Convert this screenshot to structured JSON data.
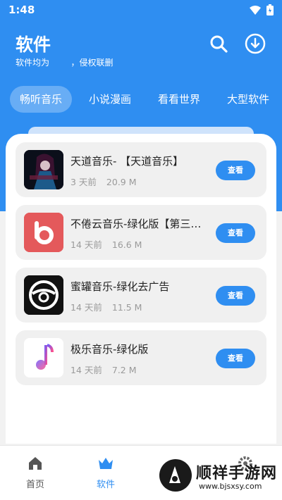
{
  "status_bar": {
    "time": "1:48"
  },
  "header": {
    "title": "软件",
    "subtitle": "软件均为        ，侵权联删"
  },
  "tabs": [
    {
      "label": "畅听音乐",
      "active": true
    },
    {
      "label": "小说漫画",
      "active": false
    },
    {
      "label": "看看世界",
      "active": false
    },
    {
      "label": "大型软件",
      "active": false
    }
  ],
  "apps": [
    {
      "name": "天道音乐-        【天道音乐】",
      "age": "3 天前",
      "size": "20.9 M",
      "button": "查看",
      "icon": "tiandao-music-icon"
    },
    {
      "name": "不倦云音乐-绿化版【第三方】",
      "age": "14 天前",
      "size": "16.6 M",
      "button": "查看",
      "icon": "bujuan-cloud-music-icon"
    },
    {
      "name": "蜜罐音乐-绿化去广告",
      "age": "14 天前",
      "size": "11.5 M",
      "button": "查看",
      "icon": "miguan-music-icon"
    },
    {
      "name": "极乐音乐-绿化版",
      "age": "14 天前",
      "size": "7.2 M",
      "button": "查看",
      "icon": "jile-music-icon"
    }
  ],
  "bottom_nav": [
    {
      "label": "首页",
      "active": false
    },
    {
      "label": "软件",
      "active": true
    }
  ],
  "watermark": {
    "name": "顺祥手游网",
    "url": "www.bjsxsy.com"
  },
  "colors": {
    "primary": "#2f8ef1",
    "card_bg": "#f0f0f0"
  }
}
